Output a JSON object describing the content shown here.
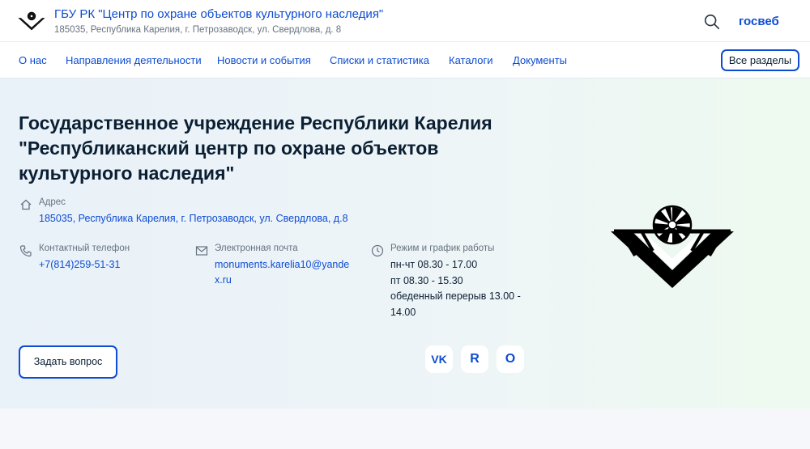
{
  "header": {
    "org_title": "ГБУ РК \"Центр по охране объектов культурного наследия\"",
    "org_address": "185035, Республика Карелия, г. Петрозаводск, ул. Свердлова, д. 8",
    "search_icon": "search-icon",
    "gosweb_label": "госвеб"
  },
  "nav": {
    "items": [
      "О нас",
      "Направления деятельности",
      "Новости и события",
      "Списки и статистика",
      "Каталоги",
      "Документы"
    ],
    "all_sections_label": "Все разделы"
  },
  "hero": {
    "title": "Государственное учреждение Республики Карелия \"Республиканский центр по охране объектов культурного наследия\"",
    "address": {
      "label": "Адрес",
      "value": "185035, Республика Карелия, г. Петрозаводск, ул. Свердлова, д.8",
      "icon": "home-icon"
    },
    "phone": {
      "label": "Контактный телефон",
      "value": "+7(814)259-51-31",
      "icon": "phone-icon"
    },
    "email": {
      "label": "Электронная почта",
      "value_line1": "monuments.karelia10@yande",
      "value_line2": "x.ru",
      "icon": "mail-icon"
    },
    "schedule": {
      "label": "Режим и график работы",
      "line1": "пн-чт 08.30 - 17.00",
      "line2": "пт 08.30 - 15.30",
      "line3": "обеденный перерыв 13.00 -",
      "line4": "14.00",
      "icon": "clock-icon"
    },
    "ask_button_label": "Задать вопрос",
    "social": [
      {
        "icon": "vk-icon",
        "glyph": "VK"
      },
      {
        "icon": "rutube-icon",
        "glyph": "R"
      },
      {
        "icon": "ok-icon",
        "glyph": "O"
      }
    ]
  },
  "colors": {
    "accent": "#0d4cd3",
    "text": "#0b1f33",
    "muted": "#66727f"
  }
}
